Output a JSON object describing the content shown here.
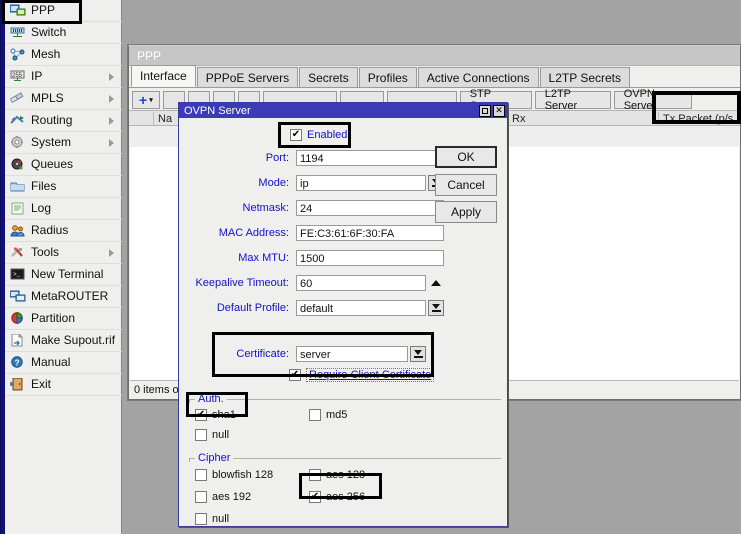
{
  "colors": {
    "desktop": "#a3a3a3",
    "dialog_title_bar": "#3b3bb7",
    "label_blue": "#1212c8",
    "sidebar_strip": "#151580",
    "window_bg": "#efefee"
  },
  "sidebar": {
    "items": [
      {
        "label": "PPP",
        "icon": "ppp-icon",
        "submenu": false,
        "highlighted": true
      },
      {
        "label": "Switch",
        "icon": "switch-icon",
        "submenu": false
      },
      {
        "label": "Mesh",
        "icon": "mesh-icon",
        "submenu": false
      },
      {
        "label": "IP",
        "icon": "ip-icon",
        "submenu": true
      },
      {
        "label": "MPLS",
        "icon": "mpls-icon",
        "submenu": true
      },
      {
        "label": "Routing",
        "icon": "routing-icon",
        "submenu": true
      },
      {
        "label": "System",
        "icon": "system-icon",
        "submenu": true
      },
      {
        "label": "Queues",
        "icon": "queues-icon",
        "submenu": false
      },
      {
        "label": "Files",
        "icon": "files-icon",
        "submenu": false
      },
      {
        "label": "Log",
        "icon": "log-icon",
        "submenu": false
      },
      {
        "label": "Radius",
        "icon": "radius-icon",
        "submenu": false
      },
      {
        "label": "Tools",
        "icon": "tools-icon",
        "submenu": true
      },
      {
        "label": "New Terminal",
        "icon": "terminal-icon",
        "submenu": false
      },
      {
        "label": "MetaROUTER",
        "icon": "metarouter-icon",
        "submenu": false
      },
      {
        "label": "Partition",
        "icon": "partition-icon",
        "submenu": false
      },
      {
        "label": "Make Supout.rif",
        "icon": "supout-icon",
        "submenu": false
      },
      {
        "label": "Manual",
        "icon": "manual-icon",
        "submenu": false
      },
      {
        "label": "Exit",
        "icon": "exit-icon",
        "submenu": false
      }
    ]
  },
  "ppp_window": {
    "title": "PPP",
    "tabs": [
      {
        "label": "Interface",
        "active": true
      },
      {
        "label": "PPPoE Servers",
        "active": false
      },
      {
        "label": "Secrets",
        "active": false
      },
      {
        "label": "Profiles",
        "active": false
      },
      {
        "label": "Active Connections",
        "active": false
      },
      {
        "label": "L2TP Secrets",
        "active": false
      }
    ],
    "toolbar": {
      "add_label": "+",
      "add_caret": "▾",
      "server_buttons": [
        {
          "label": "STP Server",
          "highlighted": false
        },
        {
          "label": "L2TP Server",
          "highlighted": false
        },
        {
          "label": "OVPN Server",
          "highlighted": true
        }
      ]
    },
    "grid_columns": [
      "Na",
      "Rx",
      "Tx Packet (p/s"
    ],
    "status": "0 items o"
  },
  "dialog": {
    "title": "OVPN Server",
    "window_buttons": {
      "maximize": "maximize-icon",
      "close": "✕"
    },
    "enabled": {
      "label": "Enabled",
      "checked": true,
      "highlighted": true
    },
    "fields": [
      {
        "name": "port",
        "label": "Port:",
        "value": "1194",
        "control": "text"
      },
      {
        "name": "mode",
        "label": "Mode:",
        "value": "ip",
        "control": "dropdown"
      },
      {
        "name": "netmask",
        "label": "Netmask:",
        "value": "24",
        "control": "text"
      },
      {
        "name": "mac-address",
        "label": "MAC Address:",
        "value": "FE:C3:61:6F:30:FA",
        "control": "text"
      },
      {
        "name": "max-mtu",
        "label": "Max MTU:",
        "value": "1500",
        "control": "text"
      },
      {
        "name": "keepalive-timeout",
        "label": "Keepalive Timeout:",
        "value": "60",
        "control": "spinner"
      },
      {
        "name": "default-profile",
        "label": "Default Profile:",
        "value": "default",
        "control": "dropdown"
      }
    ],
    "buttons": [
      {
        "label": "OK",
        "default": true
      },
      {
        "label": "Cancel",
        "default": false
      },
      {
        "label": "Apply",
        "default": false
      }
    ],
    "certificate": {
      "label": "Certificate:",
      "value": "server",
      "require_client_certificate": {
        "label": "Require Client Certificate",
        "checked": true,
        "focused": true
      },
      "highlighted": true
    },
    "auth": {
      "group_label": "Auth.",
      "options": [
        {
          "label": "sha1",
          "checked": true,
          "highlighted": true
        },
        {
          "label": "md5",
          "checked": false,
          "highlighted": false
        },
        {
          "label": "null",
          "checked": false,
          "highlighted": false
        }
      ]
    },
    "cipher": {
      "group_label": "Cipher",
      "options": [
        {
          "label": "blowfish 128",
          "checked": false,
          "highlighted": false
        },
        {
          "label": "aes 128",
          "checked": false,
          "highlighted": false
        },
        {
          "label": "aes 192",
          "checked": false,
          "highlighted": false
        },
        {
          "label": "aes 256",
          "checked": true,
          "highlighted": true
        },
        {
          "label": "null",
          "checked": false,
          "highlighted": false
        }
      ]
    }
  }
}
